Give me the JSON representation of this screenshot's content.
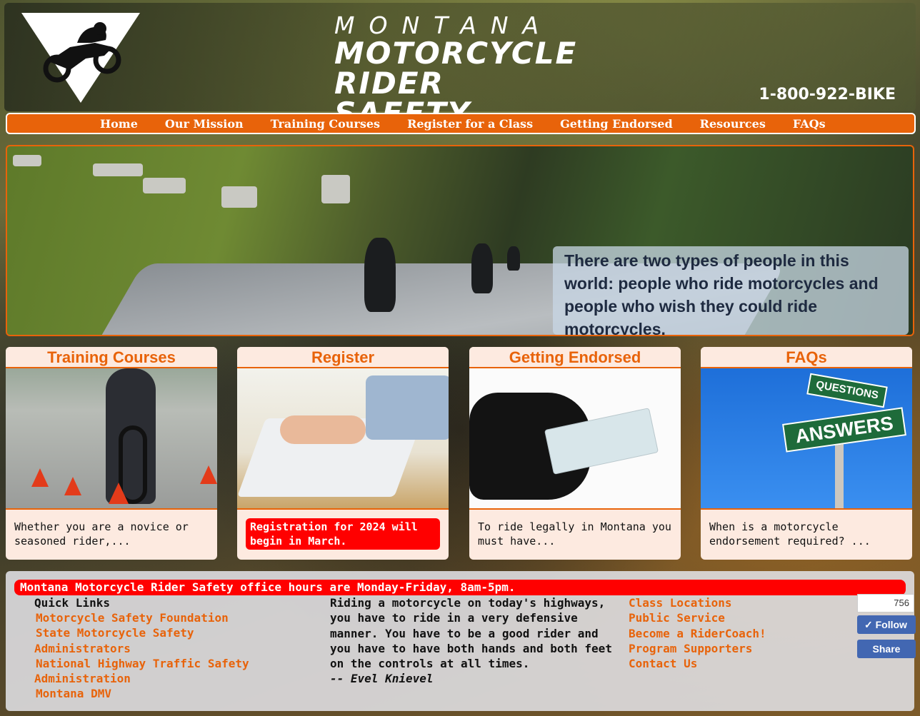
{
  "header": {
    "title_small": "MONTANA",
    "title_line1": "MOTORCYCLE",
    "title_line2": "RIDER SAFETY",
    "phone": "1-800-922-BIKE"
  },
  "nav": {
    "items": [
      "Home",
      "Our Mission",
      "Training Courses",
      "Register for a Class",
      "Getting Endorsed",
      "Resources",
      "FAQs"
    ]
  },
  "hero": {
    "quote": "There are two types of people in this world: people who ride motorcycles and people who wish they could ride motorcycles."
  },
  "cards": [
    {
      "title": "Training Courses",
      "desc": "Whether you are a novice or seasoned rider,..."
    },
    {
      "title": "Register",
      "desc": "Registration for 2024 will begin in March."
    },
    {
      "title": "Getting Endorsed",
      "desc": "To ride legally in Montana you must have..."
    },
    {
      "title": "FAQs",
      "desc": "When is a motorcycle endorsement required? ..."
    }
  ],
  "faq_sign": {
    "top": "QUESTIONS",
    "bottom": "ANSWERS"
  },
  "footer": {
    "hours": "Montana Motorcycle Rider Safety office hours are Monday-Friday, 8am-5pm.",
    "quick_links_title": "Quick Links",
    "quick_links": [
      "Motorcycle Safety Foundation",
      "State Motorcycle Safety Administrators",
      "National Highway Traffic Safety Administration",
      "Montana DMV"
    ],
    "quote_text": "Riding a motorcycle on today's highways, you have to ride in a very defensive manner. You have to be a good rider and you have to have both hands and both feet on the controls at all times.",
    "quote_author": "-- Evel Knievel",
    "links": [
      "Class Locations",
      "Public Service",
      "Become a RiderCoach!",
      "Program Supporters",
      "Contact Us"
    ],
    "fb_count": "756",
    "fb_follow": "✓ Follow",
    "fb_share": "Share"
  },
  "colors": {
    "accent": "#e8630a",
    "alert": "#ff0000",
    "facebook": "#4267b2"
  }
}
